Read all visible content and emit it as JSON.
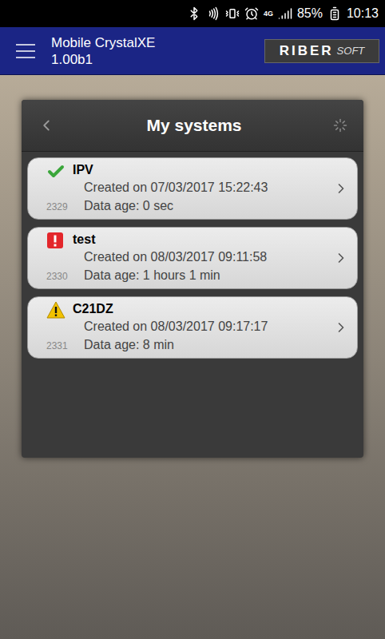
{
  "status_bar": {
    "network": "4G",
    "battery": "85%",
    "time": "10:13"
  },
  "app_bar": {
    "title": "Mobile CrystalXE",
    "version": "1.00b1",
    "logo": {
      "brand": "RIBER",
      "suffix": "SOFT"
    }
  },
  "panel": {
    "title": "My systems",
    "loading": true
  },
  "systems": [
    {
      "name": "IPV",
      "created": "Created on 07/03/2017 15:22:43",
      "age": "Data age: 0 sec",
      "id": "2329",
      "status": "ok",
      "color": "#3aa63a"
    },
    {
      "name": "test",
      "created": "Created on 08/03/2017 09:11:58",
      "age": "Data age: 1 hours 1 min",
      "id": "2330",
      "status": "error",
      "color": "#e3262b"
    },
    {
      "name": "C21DZ",
      "created": "Created on 08/03/2017 09:17:17",
      "age": "Data age: 8 min",
      "id": "2331",
      "status": "warning",
      "color": "#f2c200"
    }
  ]
}
